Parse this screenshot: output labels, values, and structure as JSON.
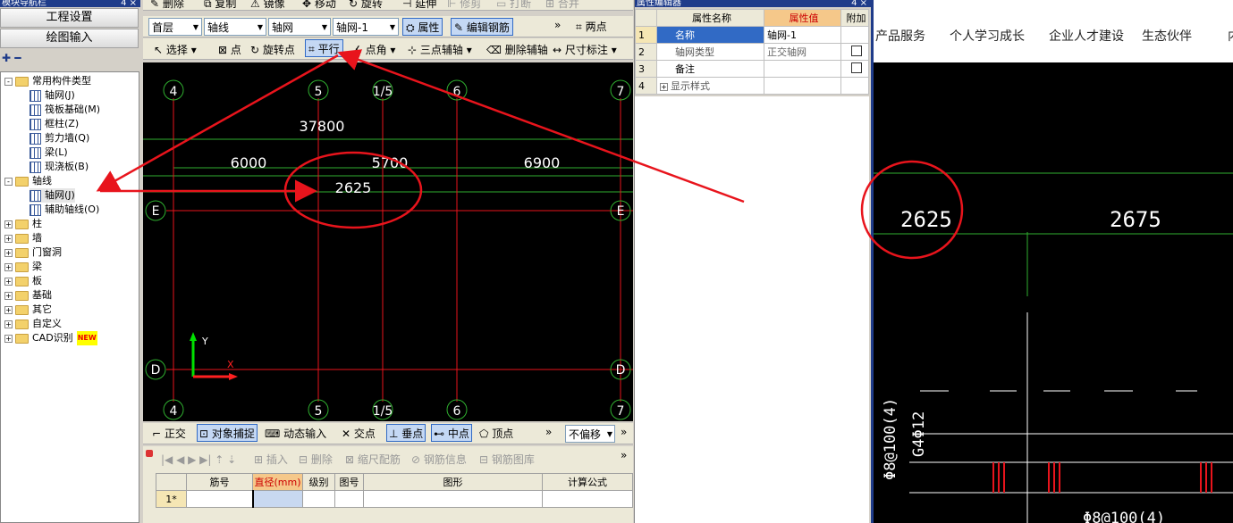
{
  "left_panel": {
    "title": "模块导航栏",
    "pin": "4 ×",
    "btn1": "工程设置",
    "btn2": "绘图输入",
    "tools": "✚ ━",
    "tree": [
      {
        "label": "常用构件类型",
        "depth": 0,
        "type": "folder",
        "exp": "-"
      },
      {
        "label": "轴网(J)",
        "depth": 1,
        "type": "item"
      },
      {
        "label": "筏板基础(M)",
        "depth": 1,
        "type": "item"
      },
      {
        "label": "框柱(Z)",
        "depth": 1,
        "type": "item"
      },
      {
        "label": "剪力墙(Q)",
        "depth": 1,
        "type": "item"
      },
      {
        "label": "梁(L)",
        "depth": 1,
        "type": "item"
      },
      {
        "label": "现浇板(B)",
        "depth": 1,
        "type": "item"
      },
      {
        "label": "轴线",
        "depth": 0,
        "type": "folder",
        "exp": "-"
      },
      {
        "label": "轴网(J)",
        "depth": 1,
        "type": "item",
        "selected": true
      },
      {
        "label": "辅助轴线(O)",
        "depth": 1,
        "type": "item"
      },
      {
        "label": "柱",
        "depth": 0,
        "type": "folder",
        "exp": "+"
      },
      {
        "label": "墙",
        "depth": 0,
        "type": "folder",
        "exp": "+"
      },
      {
        "label": "门窗洞",
        "depth": 0,
        "type": "folder",
        "exp": "+"
      },
      {
        "label": "梁",
        "depth": 0,
        "type": "folder",
        "exp": "+"
      },
      {
        "label": "板",
        "depth": 0,
        "type": "folder",
        "exp": "+"
      },
      {
        "label": "基础",
        "depth": 0,
        "type": "folder",
        "exp": "+"
      },
      {
        "label": "其它",
        "depth": 0,
        "type": "folder",
        "exp": "+"
      },
      {
        "label": "自定义",
        "depth": 0,
        "type": "folder",
        "exp": "+"
      },
      {
        "label": "CAD识别",
        "depth": 0,
        "type": "folder",
        "exp": "+",
        "badge": "NEW"
      }
    ]
  },
  "toolbar1": {
    "delete": "删除",
    "copy": "复制",
    "mirror": "镜像",
    "move": "移动",
    "rotate": "旋转",
    "extend": "延伸",
    "trim": "修剪",
    "break": "打断",
    "merge": "合并"
  },
  "toolbar2": {
    "floor": "首层",
    "type": "轴线",
    "sub": "轴网",
    "name": "轴网-1",
    "props": "属性",
    "edit_rebar": "编辑钢筋",
    "two_point": "两点",
    "more": "»"
  },
  "toolbar3": {
    "select": "选择",
    "point": "点",
    "rotate_point": "旋转点",
    "parallel": "平行",
    "point_angle": "点角",
    "three_point": "三点辅轴",
    "delete_aux": "删除辅轴",
    "dim": "尺寸标注",
    "more": "»"
  },
  "canvas": {
    "top_axes": [
      "4",
      "5",
      "1/5",
      "6",
      "7"
    ],
    "bottom_axes": [
      "4",
      "5",
      "1/5",
      "6",
      "7"
    ],
    "row_axes": [
      "E",
      "D"
    ],
    "dims": {
      "total": "37800",
      "a": "6000",
      "b": "5700",
      "c": "6900",
      "d": "2625"
    },
    "ucs_x": "X",
    "ucs_y": "Y"
  },
  "snapbar": {
    "ortho": "正交",
    "osnap": "对象捕捉",
    "dyn": "动态输入",
    "intersect": "交点",
    "perp": "垂点",
    "mid": "中点",
    "vertex": "顶点",
    "offset": "不偏移",
    "more": "»"
  },
  "rebar_toolbar": {
    "insert": "插入",
    "delete": "删除",
    "scale": "缩尺配筋",
    "info": "钢筋信息",
    "lib": "钢筋图库",
    "more": "»"
  },
  "rebar_table": {
    "headers": [
      "筋号",
      "直径(mm)",
      "级别",
      "图号",
      "图形",
      "计算公式"
    ],
    "row_label": "1*"
  },
  "prop_editor": {
    "title": "属性编辑器",
    "pin": "4 ×",
    "headers": [
      "属性名称",
      "属性值",
      "附加"
    ],
    "rows": [
      {
        "n": "1",
        "name": "名称",
        "value": "轴网-1",
        "chk": false
      },
      {
        "n": "2",
        "name": "轴网类型",
        "value": "正交轴网",
        "chk": true
      },
      {
        "n": "3",
        "name": "备注",
        "value": "",
        "chk": true
      },
      {
        "n": "4",
        "name": "显示样式",
        "value": "",
        "chk": false,
        "exp": "+"
      }
    ]
  },
  "browser": {
    "nav": [
      "产品服务",
      "个人学习成长",
      "企业人才建设",
      "生态伙伴",
      "内"
    ],
    "dims": {
      "a": "2625",
      "b": "2675"
    },
    "rebar1": "Φ8@100(4)",
    "rebar2": "G4Φ12",
    "rebar3": "Φ8@100(4)"
  },
  "colors": {
    "annot": "#e8141c",
    "axis": "#e8141c",
    "grid_green": "#2fae2f",
    "bg": "#000000",
    "selected_tab": "#316ac5"
  }
}
